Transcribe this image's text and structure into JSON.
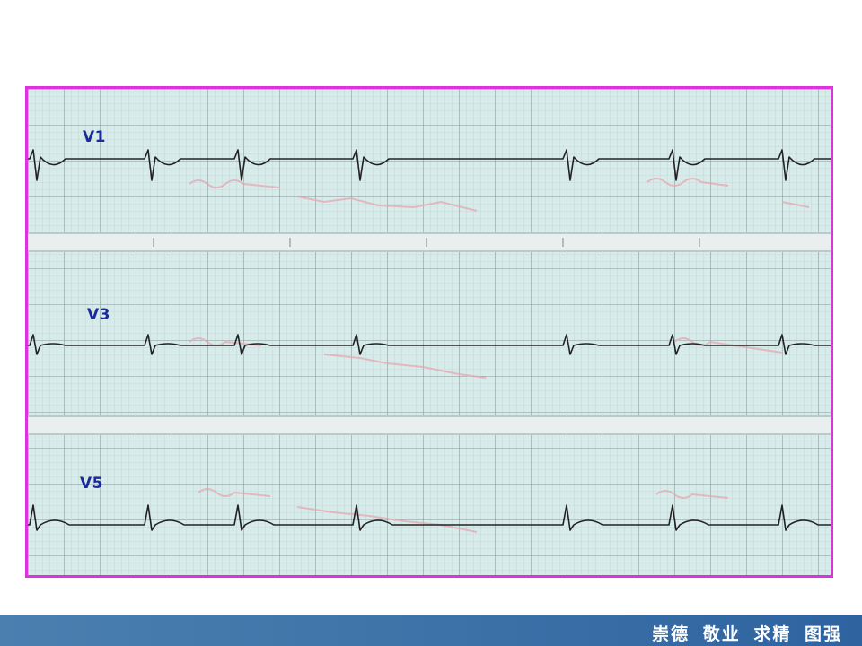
{
  "ecg": {
    "leads": [
      {
        "id": "v1",
        "label": "V1"
      },
      {
        "id": "v3",
        "label": "V3"
      },
      {
        "id": "v5",
        "label": "V5"
      }
    ],
    "colors": {
      "frame_border": "#dd33dd",
      "grid_paper": "#d6ebea",
      "trace": "#222222",
      "lead_label": "#1a2a9a"
    }
  },
  "footer": {
    "motto": "崇德 敬业 求精 图强",
    "background": "#3e74a8"
  }
}
